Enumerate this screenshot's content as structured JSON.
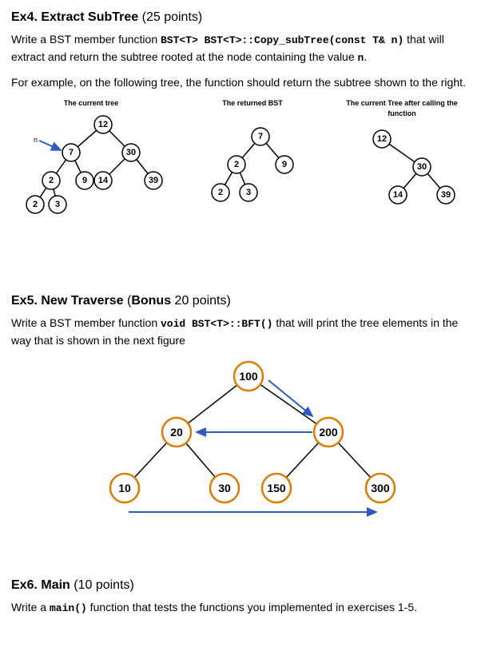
{
  "ex4": {
    "heading_bold": "Ex4. Extract SubTree",
    "heading_points": " (25 points)",
    "p1a": "Write a BST member function ",
    "code1": "BST<T> BST<T>::Copy_subTree(const T& n)",
    "p1b": " that will extract and return the subtree rooted at the node containing the value ",
    "code_n": "n",
    "p1c": ".",
    "p2": "For example, on the following tree, the function should return the subtree shown to the right.",
    "col1": "The current tree",
    "col2": "The returned BST",
    "col3": "The current Tree after calling the function",
    "tree_current": {
      "root": 12,
      "left": {
        "v": 7,
        "left": {
          "v": 2,
          "left": {
            "v": 2
          },
          "right": {
            "v": 3
          }
        },
        "right": {
          "v": 9
        },
        "right2": {
          "v": 14
        }
      },
      "right": {
        "v": 30,
        "right": {
          "v": 39
        }
      }
    },
    "tree_returned": {
      "root": 7,
      "left": {
        "v": 2,
        "left": {
          "v": 2
        },
        "right": {
          "v": 3
        }
      },
      "right": {
        "v": 9
      }
    },
    "tree_after": {
      "root": 12,
      "right": {
        "v": 30,
        "left": {
          "v": 14
        },
        "right": {
          "v": 39
        }
      }
    }
  },
  "ex5": {
    "heading_bold": "Ex5. New Traverse",
    "heading_points_pre": " (",
    "heading_points_bold": "Bonus",
    "heading_points_post": " 20 points)",
    "p1a": "Write a BST member function ",
    "code1": "void BST<T>::BFT()",
    "p1b": "  that will print the tree elements in the way that is shown in the next figure",
    "tree": {
      "root": 100,
      "left": {
        "v": 20,
        "left": {
          "v": 10
        },
        "right": {
          "v": 30
        }
      },
      "right": {
        "v": 200,
        "left": {
          "v": 150
        },
        "right": {
          "v": 300
        }
      }
    }
  },
  "ex6": {
    "heading_bold": "Ex6. Main",
    "heading_points": " (10 points)",
    "p1a": "Write a ",
    "code1": "main()",
    "p1b": " function that tests the functions you implemented in exercises 1-5."
  }
}
